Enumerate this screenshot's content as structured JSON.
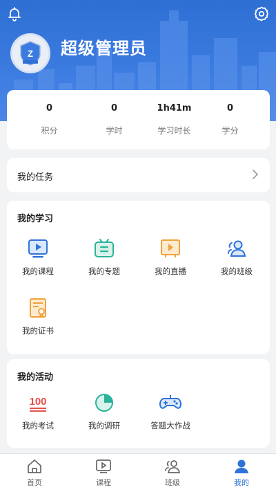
{
  "header": {
    "username": "超级管理员",
    "avatar_badge": "Z"
  },
  "stats": [
    {
      "value": "0",
      "label": "积分"
    },
    {
      "value": "0",
      "label": "学时"
    },
    {
      "value": "1h41m",
      "label": "学习时长"
    },
    {
      "value": "0",
      "label": "学分"
    }
  ],
  "tasks": {
    "title": "我的任务"
  },
  "study": {
    "title": "我的学习",
    "items": [
      {
        "label": "我的课程"
      },
      {
        "label": "我的专题"
      },
      {
        "label": "我的直播"
      },
      {
        "label": "我的班级"
      },
      {
        "label": "我的证书"
      }
    ]
  },
  "activity": {
    "title": "我的活动",
    "items": [
      {
        "label": "我的考试",
        "icon_text": "100"
      },
      {
        "label": "我的调研"
      },
      {
        "label": "答题大作战"
      }
    ]
  },
  "tabbar": {
    "items": [
      {
        "label": "首页"
      },
      {
        "label": "课程"
      },
      {
        "label": "班级"
      },
      {
        "label": "我的"
      }
    ],
    "active_color": "#2f73d9"
  },
  "colors": {
    "primary": "#2f73d9",
    "teal": "#2bb39a",
    "orange": "#f0a23b",
    "red": "#e8504a"
  }
}
